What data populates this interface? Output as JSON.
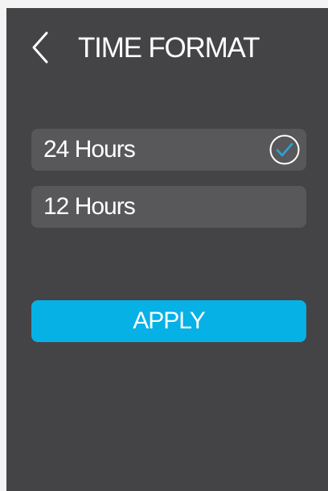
{
  "header": {
    "title": "TIME FORMAT",
    "back_icon": "chevron-left-icon"
  },
  "options": [
    {
      "label": "24 Hours",
      "selected": true,
      "icon": "check-circle-icon"
    },
    {
      "label": "12 Hours",
      "selected": false
    }
  ],
  "apply": {
    "label": "APPLY"
  },
  "colors": {
    "page_bg": "#f3f3f3",
    "screen_bg": "#444446",
    "option_bg": "#58585b",
    "accent": "#06b1e6",
    "check": "#2aa4dc",
    "text": "#ffffff"
  }
}
